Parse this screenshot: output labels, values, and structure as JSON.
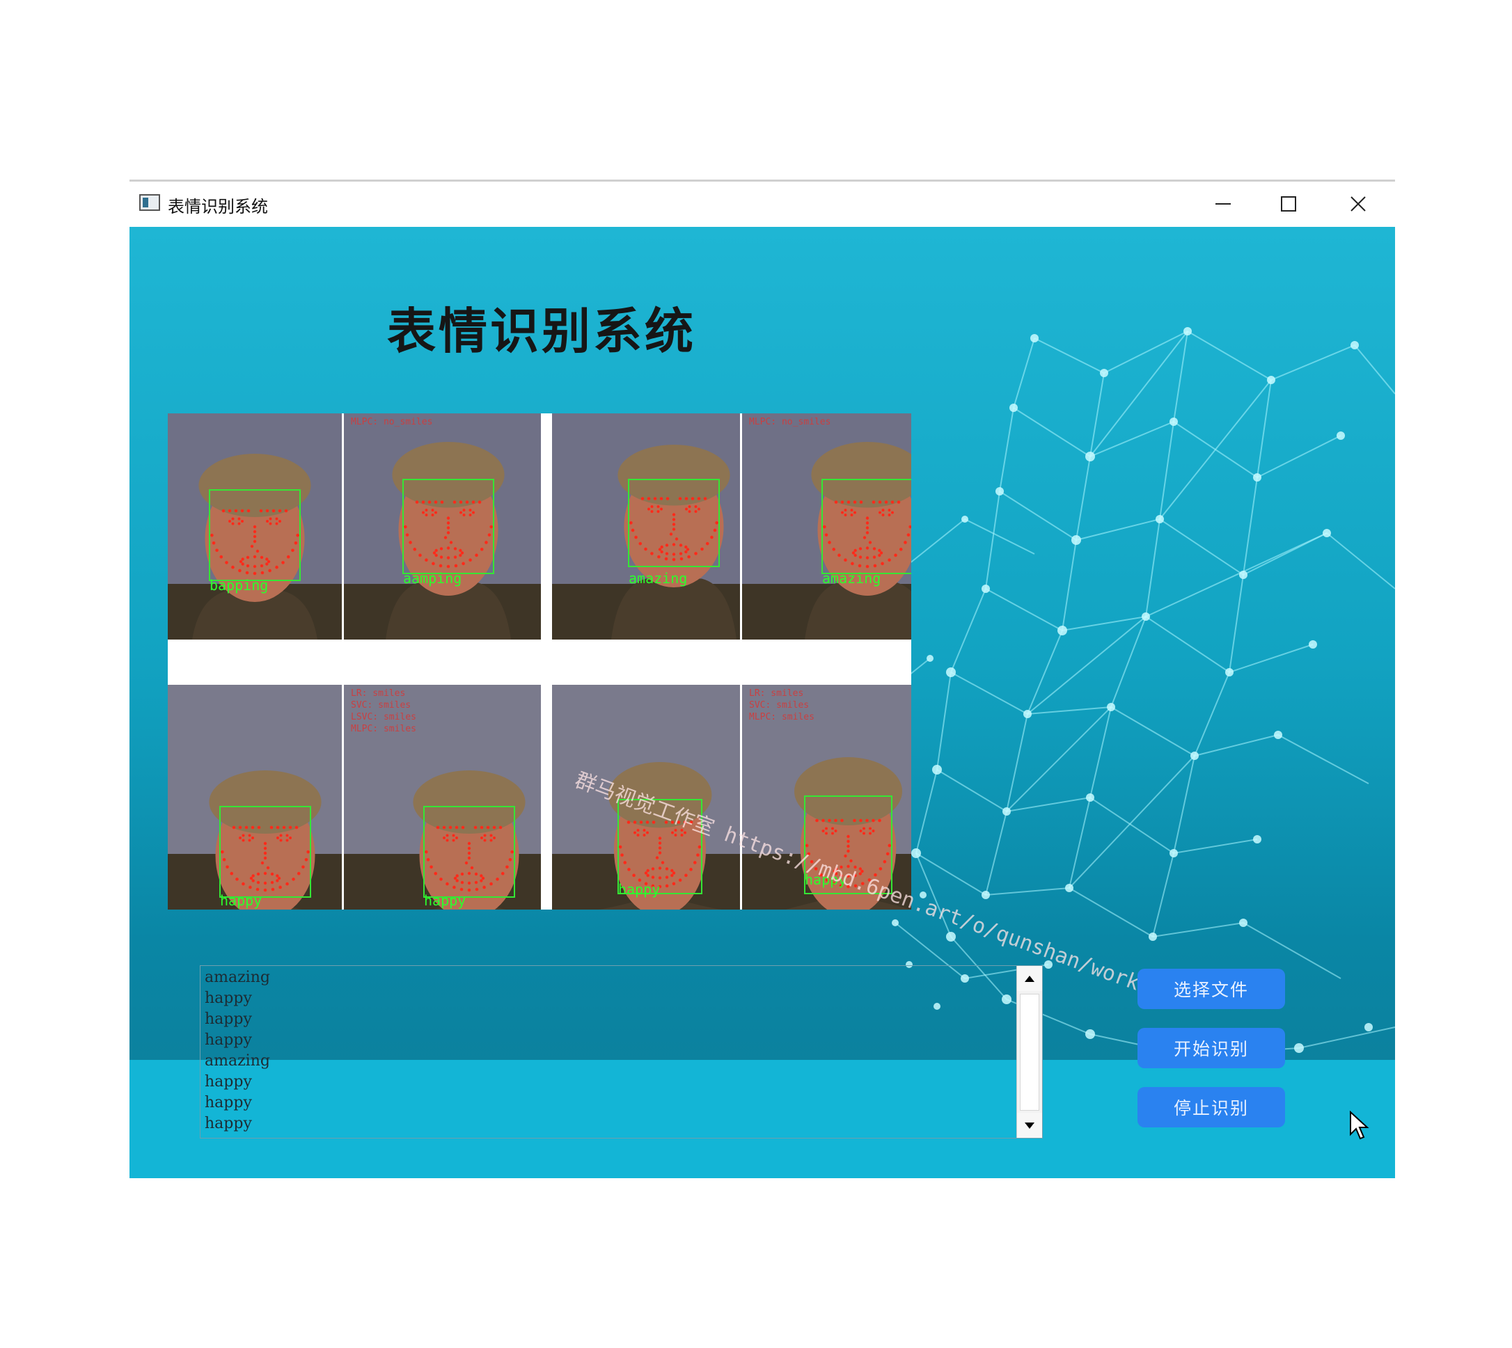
{
  "window": {
    "title": "表情识别系统",
    "minimize_icon": "minimize-icon",
    "maximize_icon": "maximize-icon",
    "close_icon": "close-icon"
  },
  "heading": "表情识别系统",
  "photos": {
    "top_row": [
      {
        "label": "bapping",
        "note": ""
      },
      {
        "label": "aamping",
        "note": "MLPC: no_smiles"
      },
      {
        "label": "amazing",
        "note": ""
      },
      {
        "label": "amazing",
        "note": "MLPC: no_smiles"
      }
    ],
    "bottom_row": [
      {
        "label": "happy",
        "note": ""
      },
      {
        "label": "happy",
        "note": "LR: smiles\nSVC: smiles\nLSVC: smiles\nMLPC: smiles"
      },
      {
        "label": "happy",
        "note": ""
      },
      {
        "label": "happy",
        "note": "LR: smiles\nSVC: smiles\nMLPC: smiles"
      }
    ]
  },
  "watermark": "群马视觉工作室  https://mbd.6pen.art/o/qunshan/work",
  "log": {
    "lines": [
      "amazing",
      "happy",
      "happy",
      "happy",
      "amazing",
      "happy",
      "happy",
      "happy"
    ]
  },
  "buttons": {
    "select_file": "选择文件",
    "start": "开始识别",
    "stop": "停止识别"
  },
  "colors": {
    "background_accent": "#13b5d6",
    "button": "#2a82f0",
    "label_green": "#2cff2c",
    "landmark_red": "#ff2a1a"
  }
}
